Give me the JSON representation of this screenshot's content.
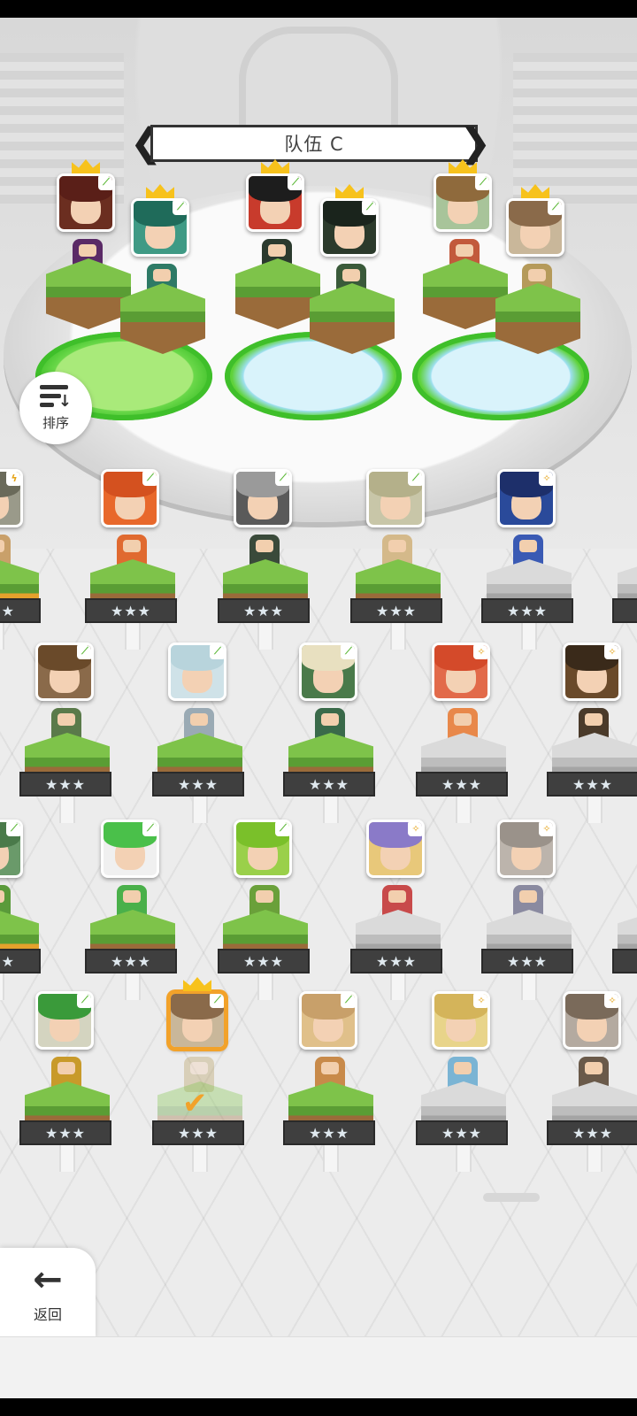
{
  "team": {
    "title": "队伍 C",
    "prev": "❮",
    "next": "❯"
  },
  "buttons": {
    "sort_label": "排序",
    "back_label": "返回",
    "back_arrow": "←"
  },
  "unit_card": {
    "stars": "★★★",
    "check": "✔"
  },
  "colors": {
    "accent_selected": "#f2a22a",
    "crown": "#f7c21c",
    "badge_green": "#5ab735",
    "stars_bar": "#3f3f3f"
  }
}
